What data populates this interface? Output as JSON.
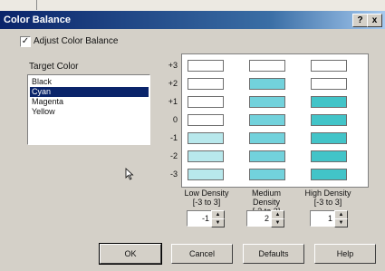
{
  "dialog": {
    "title": "Color Balance",
    "help_label": "?",
    "close_label": "x"
  },
  "adjust": {
    "checked": true,
    "check_mark": "✓",
    "label": "Adjust Color Balance"
  },
  "target": {
    "label": "Target Color",
    "items": [
      "Black",
      "Cyan",
      "Magenta",
      "Yellow"
    ],
    "selected": "Cyan"
  },
  "levels": [
    "+3",
    "+2",
    "+1",
    "0",
    "-1",
    "-2",
    "-3"
  ],
  "density": {
    "columns": [
      {
        "label": "Low Density",
        "range": "[-3 to 3]",
        "value": "-1",
        "cell_colors": [
          "c0",
          "c0",
          "c0",
          "c0",
          "c1",
          "c1",
          "c1"
        ]
      },
      {
        "label": "Medium Density",
        "range": "[-3 to 3]",
        "value": "2",
        "cell_colors": [
          "c0",
          "c2",
          "c2",
          "c2",
          "c2",
          "c2",
          "c2"
        ]
      },
      {
        "label": "High Density",
        "range": "[-3 to 3]",
        "value": "1",
        "cell_colors": [
          "c0",
          "c0",
          "c3",
          "c3",
          "c3",
          "c3",
          "c3"
        ]
      }
    ]
  },
  "colors": {
    "light": "#b8e8ec",
    "medium": "#72d2dc",
    "high": "#42c4c8"
  },
  "buttons": {
    "ok": "OK",
    "cancel": "Cancel",
    "defaults": "Defaults",
    "help": "Help"
  }
}
